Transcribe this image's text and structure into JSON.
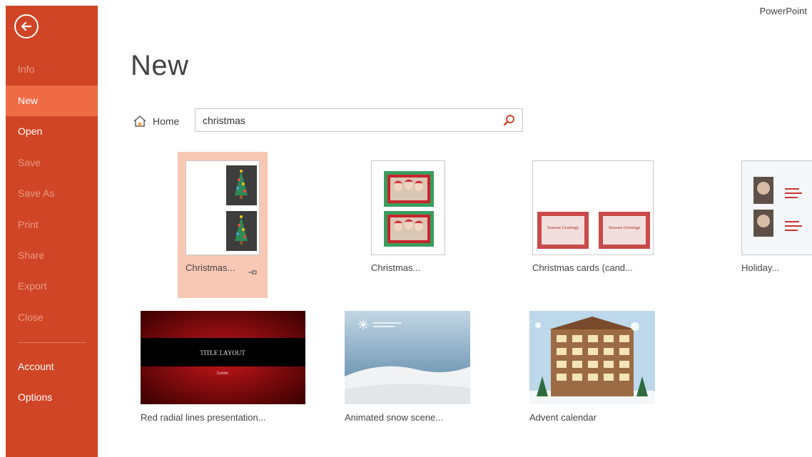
{
  "app": {
    "name": "PowerPoint"
  },
  "sidebar": {
    "back_label": "back",
    "items": [
      {
        "label": "Info",
        "enabled": false
      },
      {
        "label": "New",
        "enabled": true,
        "active": true
      },
      {
        "label": "Open",
        "enabled": true
      },
      {
        "label": "Save",
        "enabled": false
      },
      {
        "label": "Save As",
        "enabled": false
      },
      {
        "label": "Print",
        "enabled": false
      },
      {
        "label": "Share",
        "enabled": false
      },
      {
        "label": "Export",
        "enabled": false
      },
      {
        "label": "Close",
        "enabled": false
      },
      {
        "label": "Account",
        "enabled": true
      },
      {
        "label": "Options",
        "enabled": true
      }
    ]
  },
  "page": {
    "title": "New"
  },
  "search": {
    "home_label": "Home",
    "query": "christmas"
  },
  "templates": [
    {
      "label": "Christmas...",
      "selected": true,
      "pinnable": true,
      "thumb_text": []
    },
    {
      "label": "Christmas...",
      "thumb_text": []
    },
    {
      "label": "Christmas cards (cand...",
      "thumb_text": [
        "Seasons Greetings",
        "Seasons Greetings"
      ]
    },
    {
      "label": "Holiday...",
      "thumb_text": []
    },
    {
      "label": "Red radial lines presentation...",
      "thumb_text": [
        "TITLE LAYOUT",
        "Subtitle"
      ]
    },
    {
      "label": "Animated snow scene...",
      "thumb_text": []
    },
    {
      "label": "Advent calendar",
      "thumb_text": []
    }
  ],
  "colors": {
    "sidebar": "#d04525",
    "sidebar_active": "#ee6b44",
    "selected_tile": "#f8c8b4",
    "search_accent": "#d04525"
  }
}
